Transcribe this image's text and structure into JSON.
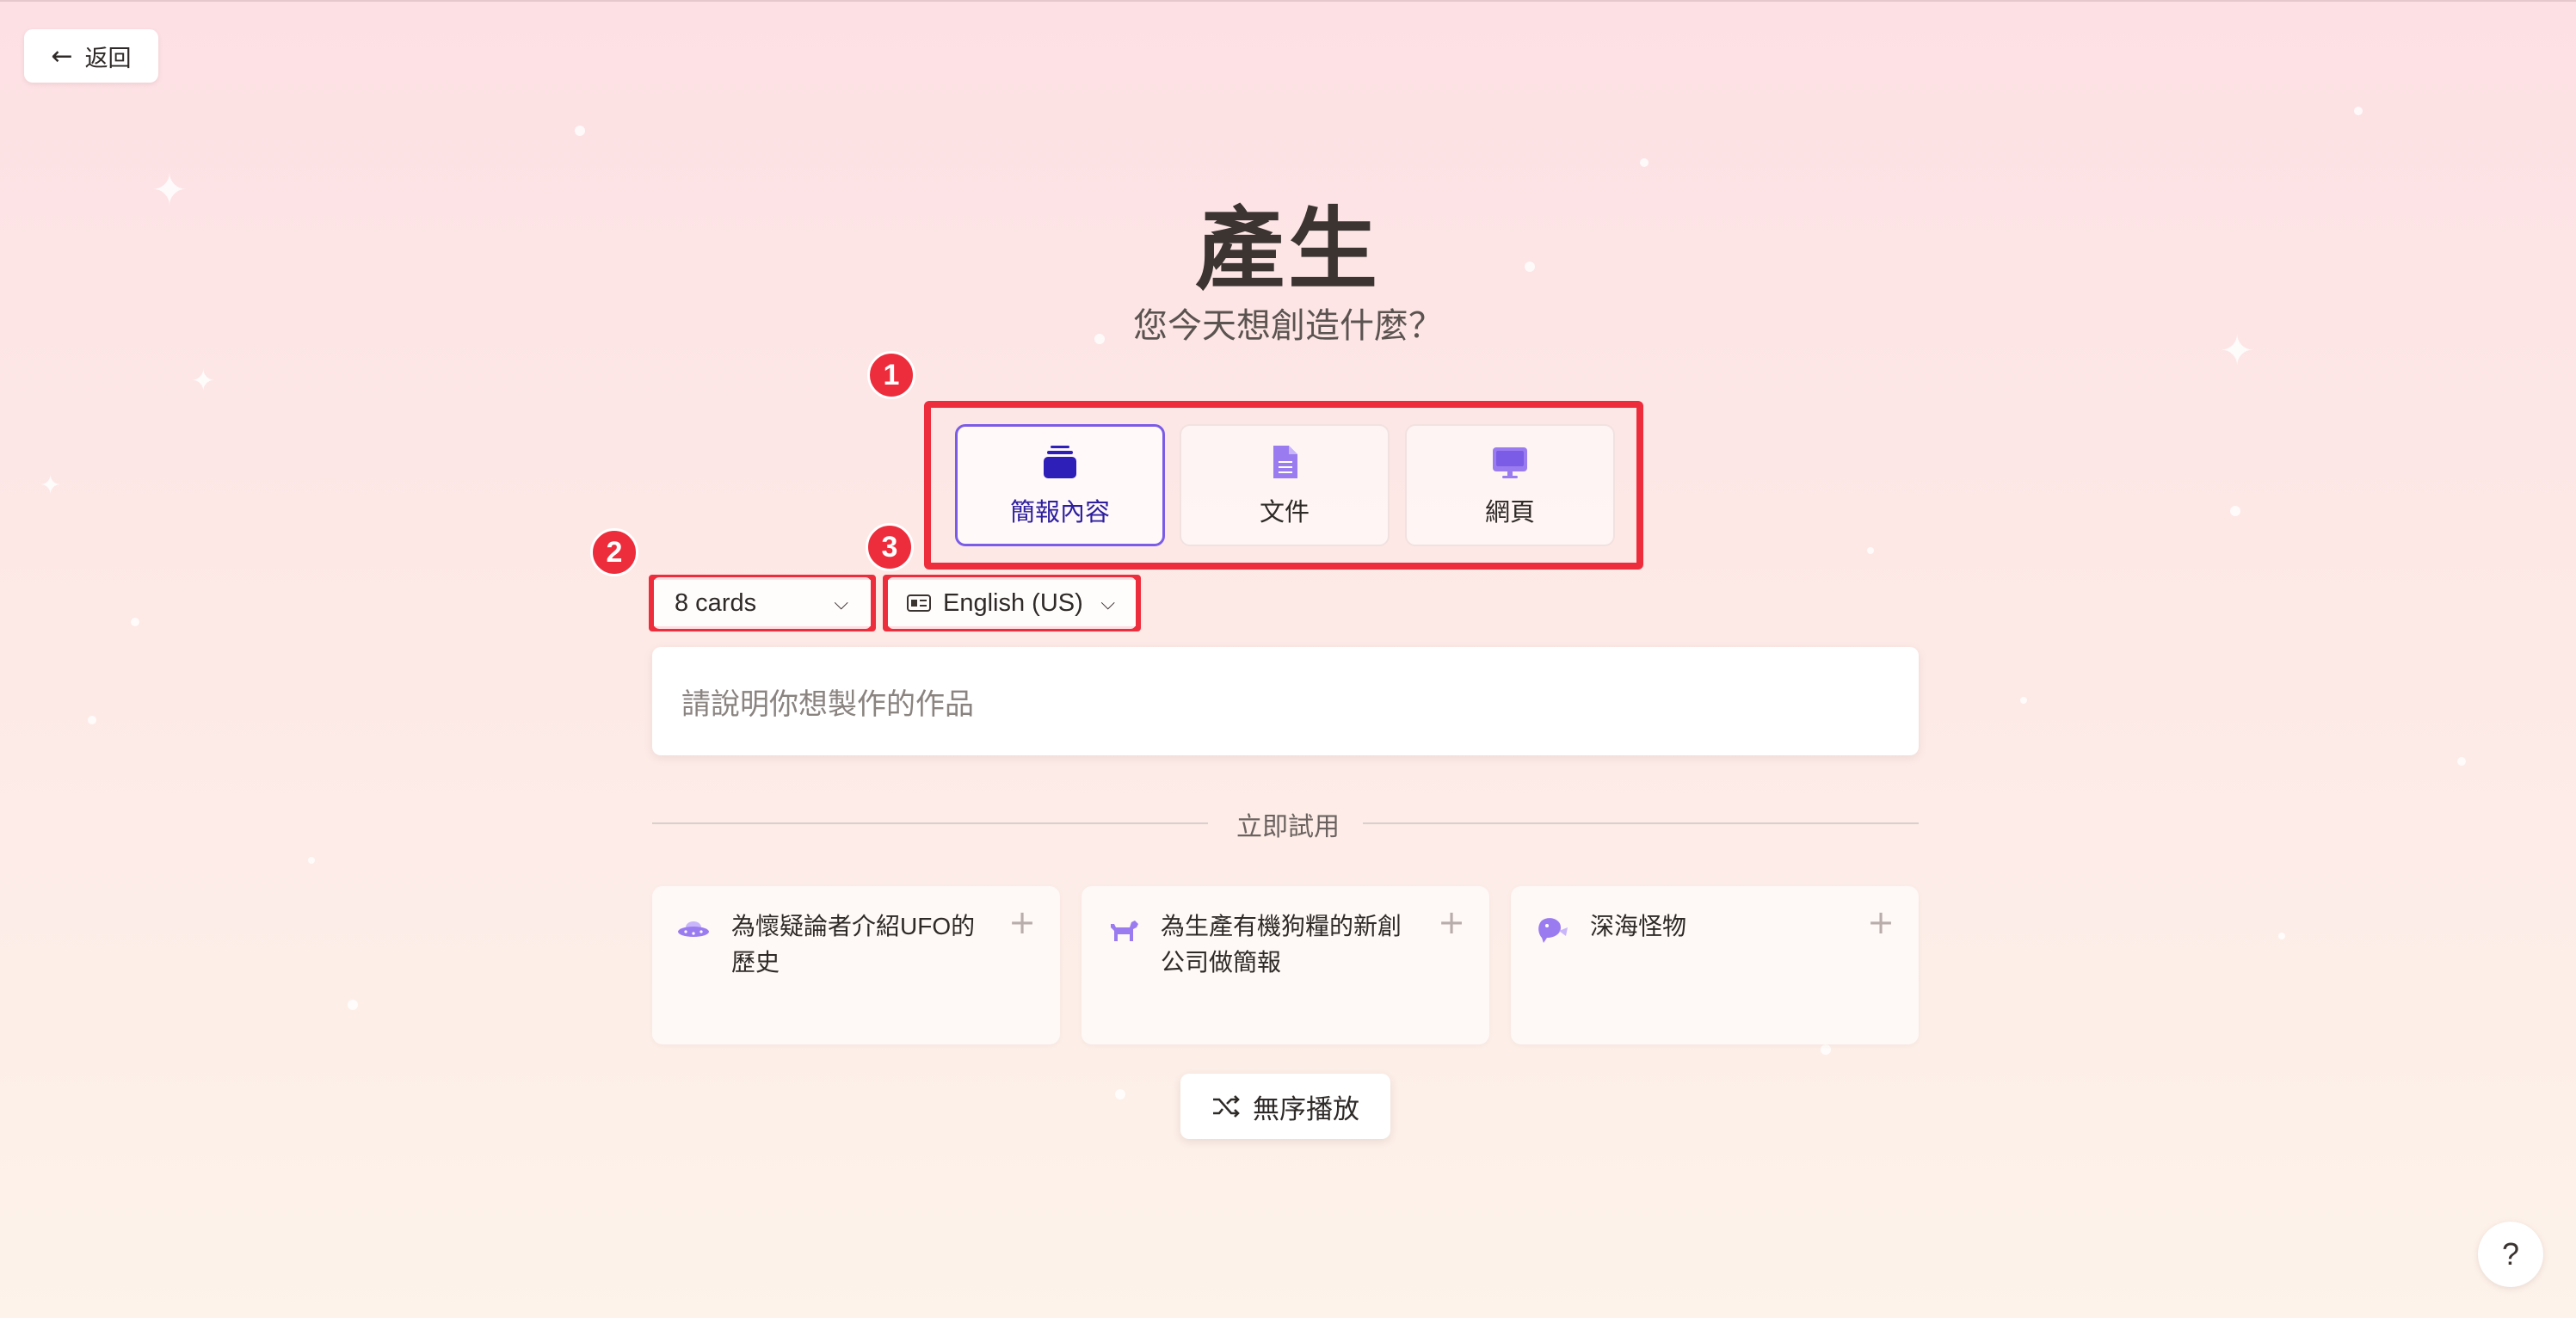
{
  "nav": {
    "back_label": "返回",
    "back_icon": "arrow-left-icon"
  },
  "header": {
    "title": "產生",
    "subtitle": "您今天想創造什麼？"
  },
  "content_types": [
    {
      "label": "簡報內容",
      "icon": "presentation-icon",
      "selected": true
    },
    {
      "label": "文件",
      "icon": "document-icon",
      "selected": false
    },
    {
      "label": "網頁",
      "icon": "webpage-icon",
      "selected": false
    }
  ],
  "options": {
    "card_count": "8 cards",
    "language": "English (US)"
  },
  "annotations": [
    "1",
    "2",
    "3"
  ],
  "prompt": {
    "placeholder": "請說明你想製作的作品"
  },
  "try_now": {
    "label": "立即試用"
  },
  "suggestions": [
    {
      "text": "為懷疑論者介紹UFO的歷史",
      "icon": "ufo-icon"
    },
    {
      "text": "為生產有機狗糧的新創公司做簡報",
      "icon": "dog-icon"
    },
    {
      "text": "深海怪物",
      "icon": "sea-monster-icon"
    }
  ],
  "shuffle": {
    "label": "無序播放",
    "icon": "shuffle-icon"
  },
  "help": {
    "label": "?"
  },
  "colors": {
    "accent": "#7b5ce6",
    "annotation_red": "#ee2d3c",
    "icon_purple": "#9b7cf0"
  }
}
